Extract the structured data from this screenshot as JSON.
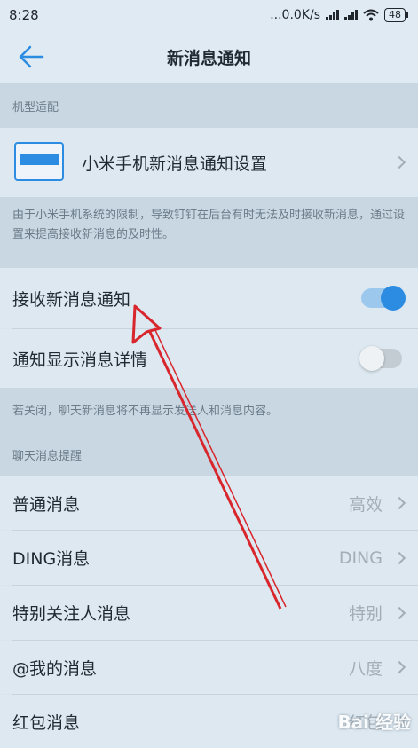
{
  "status": {
    "time": "8:28",
    "speed": "...0.0K/s",
    "battery": "48"
  },
  "header": {
    "title": "新消息通知"
  },
  "device_section": {
    "header": "机型适配",
    "item_label": "小米手机新消息通知设置",
    "note": "由于小米手机系统的限制，导致钉钉在后台有时无法及时接收新消息，通过设置来提高接收新消息的及时性。"
  },
  "notify_section": {
    "receive_label": "接收新消息通知",
    "receive_on": true,
    "detail_label": "通知显示消息详情",
    "detail_on": false,
    "note": "若关闭，聊天新消息将不再显示发送人和消息内容。"
  },
  "chat_section": {
    "header": "聊天消息提醒",
    "items": [
      {
        "label": "普通消息",
        "value": "高效"
      },
      {
        "label": "DING消息",
        "value": "DING"
      },
      {
        "label": "特别关注人消息",
        "value": "特别"
      },
      {
        "label": "@我的消息",
        "value": "八度"
      },
      {
        "label": "红包消息",
        "value": "红包"
      }
    ]
  },
  "watermark": "Bai 经验",
  "colors": {
    "accent": "#2c8ce2",
    "annotation": "#d8262c"
  }
}
